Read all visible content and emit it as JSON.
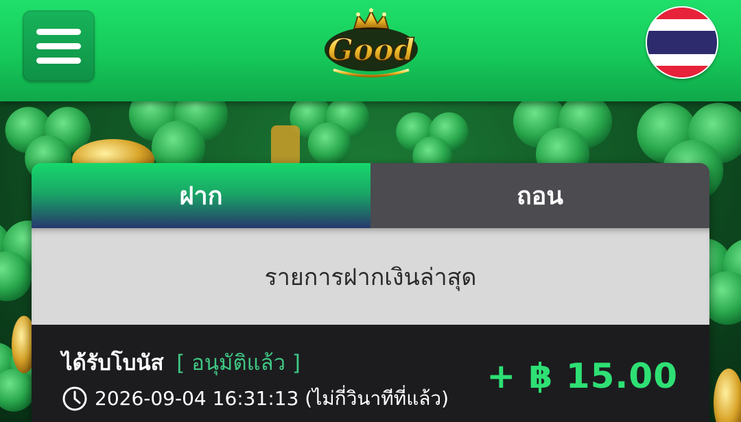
{
  "header": {
    "logo_text": "Good",
    "menu_icon": "hamburger-menu-icon",
    "flag_icon": "thailand-flag-icon"
  },
  "colors": {
    "header_green": "#1fe06a",
    "accent_green": "#2ee074",
    "status_green": "#3fc783",
    "inactive_tab": "#4b4b50",
    "list_bg": "#1c1c1f"
  },
  "tabs": [
    {
      "label": "ฝาก",
      "active": true
    },
    {
      "label": "ถอน",
      "active": false
    }
  ],
  "section": {
    "title": "รายการฝากเงินล่าสุด"
  },
  "transactions": [
    {
      "title": "ได้รับโบนัส",
      "status": "[ อนุมัติแล้ว ]",
      "datetime": "2026-09-04 16:31:13 (ไม่กี่วินาทีที่แล้ว)",
      "amount": "+ ฿ 15.00",
      "icon": "clock-icon"
    }
  ]
}
